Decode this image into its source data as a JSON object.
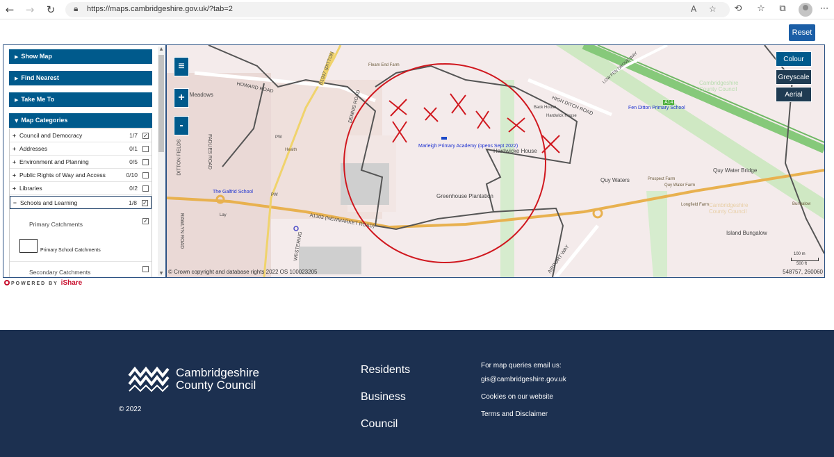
{
  "browser": {
    "url": "https://maps.cambridgeshire.gov.uk/?tab=2",
    "back_icon": "arrow-left-icon",
    "forward_icon": "arrow-right-icon",
    "refresh_icon": "refresh-icon"
  },
  "reset_label": "Reset",
  "sidebar": {
    "show_map": "Show Map",
    "find_nearest": "Find Nearest",
    "take_me_to": "Take Me To",
    "map_categories": "Map Categories",
    "categories": [
      {
        "label": "Council and Democracy",
        "count": "1/7",
        "checked": true
      },
      {
        "label": "Addresses",
        "count": "0/1",
        "checked": false
      },
      {
        "label": "Environment and Planning",
        "count": "0/5",
        "checked": false
      },
      {
        "label": "Public Rights of Way and Access",
        "count": "0/10",
        "checked": false
      },
      {
        "label": "Libraries",
        "count": "0/2",
        "checked": false
      },
      {
        "label": "Schools and Learning",
        "count": "1/8",
        "checked": true
      }
    ],
    "sub": {
      "primary_catchments": "Primary Catchments",
      "primary_school_catchments": "Primary School Catchments",
      "secondary_catchments": "Secondary Catchments"
    }
  },
  "powered_by": "POWERED BY",
  "ishare": "iShare",
  "map": {
    "layers": {
      "colour": "Colour",
      "greyscale": "Greyscale",
      "aerial": "Aerial"
    },
    "zoom_in": "+",
    "zoom_out": "-",
    "copyright": "© Crown copyright and database rights 2022 OS 100023205",
    "coords": "548757, 260060",
    "scale_m": "100 m",
    "scale_ft": "500 ft",
    "labels": {
      "marleigh": "Marleigh Primary Academy (opens Sept 2022)",
      "fen_ditton": "Fen Ditton Primary School",
      "galfrid": "The Galfrid School",
      "howard_road": "HOWARD ROAD",
      "high_ditch": "HIGH DITCH ROAD",
      "a1303": "A1303 (NEWMARKET ROAD)",
      "greenhouse": "Greenhouse Plantation",
      "hardwicke": "Hardwicke House",
      "quy_waters": "Quy Waters",
      "quy_water_bridge": "Quy Water Bridge",
      "quy_water_farm": "Quy Water Farm",
      "prospect_farm": "Prospect Farm",
      "longfield_farm": "Longfield Farm",
      "island_bungalow": "Island Bungalow",
      "fleam_end": "Fleam End Farm",
      "back_house": "Back House",
      "hardwick_house_small": "Hardwick House",
      "low_fen_drove": "LOW FEN DROVE WAY",
      "a14": "A14",
      "dittons_meadows": "n Meadows",
      "ditton_fields": "DITTON FIELDS",
      "fadlies_road": "FADLIES ROAD",
      "rawlyn_road": "RAWLYN ROAD",
      "dennis_road": "DENNIS ROAD",
      "b1047": "B1047 (DITTON",
      "airport_way": "AIRPORT WAY",
      "westering": "WESTERING",
      "health": "Health",
      "pw": "PW",
      "lay": "Lay",
      "bungalow": "Bungalow",
      "ccc_watermark": "Cambridgeshire County Council"
    }
  },
  "footer": {
    "logo_line1": "Cambridgeshire",
    "logo_line2": "County Council",
    "copyright": "© 2022",
    "links": [
      "Residents",
      "Business",
      "Council"
    ],
    "map_queries": "For map queries email us:",
    "email": "gis@cambridgeshire.gov.uk",
    "cookies": "Cookies on our website",
    "terms": "Terms and Disclaimer"
  }
}
